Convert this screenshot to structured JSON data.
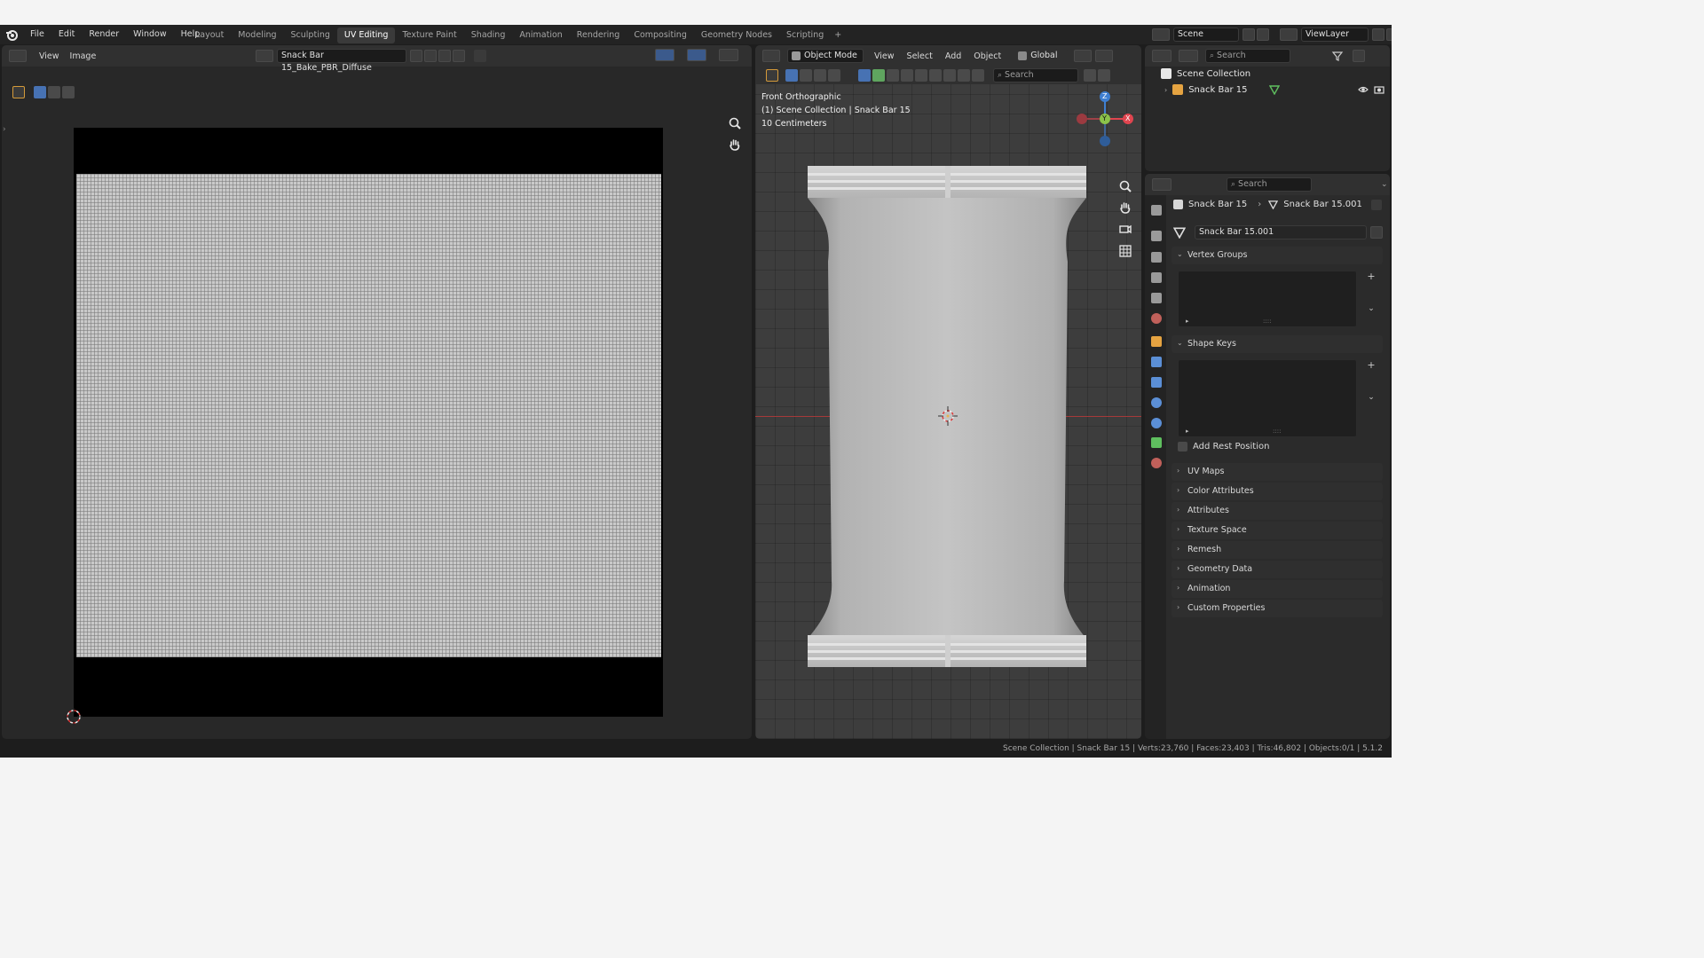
{
  "menu": {
    "file": "File",
    "edit": "Edit",
    "render": "Render",
    "window": "Window",
    "help": "Help"
  },
  "workspaces": [
    "Layout",
    "Modeling",
    "Sculpting",
    "UV Editing",
    "Texture Paint",
    "Shading",
    "Animation",
    "Rendering",
    "Compositing",
    "Geometry Nodes",
    "Scripting"
  ],
  "workspace_add": "+",
  "top_right": {
    "scene": "Scene",
    "view_layer": "ViewLayer"
  },
  "uv_editor": {
    "menu_view": "View",
    "menu_image": "Image",
    "image_name": "Snack Bar 15_Bake_PBR_Diffuse"
  },
  "viewport": {
    "mode": "Object Mode",
    "menu_view": "View",
    "menu_select": "Select",
    "menu_add": "Add",
    "menu_object": "Object",
    "transform_orientation": "Global",
    "search_placeholder": "Search",
    "overlay_line1": "Front Orthographic",
    "overlay_line2": "(1) Scene Collection | Snack Bar 15",
    "overlay_line3": "10 Centimeters",
    "gizmo_z": "Z",
    "gizmo_y": "Y",
    "gizmo_x": "X"
  },
  "outliner": {
    "search_placeholder": "Search",
    "collection": "Scene Collection",
    "object": "Snack Bar 15"
  },
  "properties": {
    "search_placeholder": "Search",
    "breadcrumb_object": "Snack Bar 15",
    "breadcrumb_mesh": "Snack Bar 15.001",
    "mesh_name": "Snack Bar 15.001",
    "vertex_groups": "Vertex Groups",
    "shape_keys": "Shape Keys",
    "add_rest_position": "Add Rest Position",
    "panels": [
      "UV Maps",
      "Color Attributes",
      "Attributes",
      "Texture Space",
      "Remesh",
      "Geometry Data",
      "Animation",
      "Custom Properties"
    ]
  },
  "statusbar": {
    "text": "Scene Collection | Snack Bar 15 | Verts:23,760 | Faces:23,403 | Tris:46,802 | Objects:0/1 | 5.1.2"
  },
  "colors": {
    "accent": "#4772b3",
    "axis_x": "#e0454f",
    "axis_y": "#8bc34a",
    "axis_z": "#3f7fd1",
    "mesh_data": "#5fbf5f"
  }
}
